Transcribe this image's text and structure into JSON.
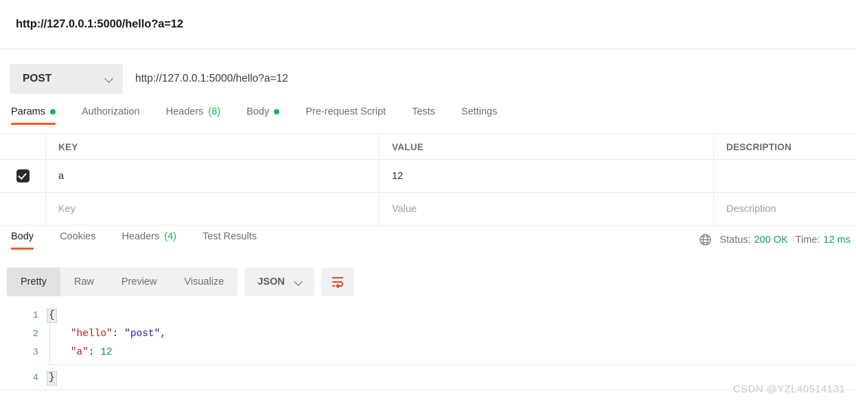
{
  "titlebar": {
    "title": "http://127.0.0.1:5000/hello?a=12"
  },
  "request": {
    "method": "POST",
    "url": "http://127.0.0.1:5000/hello?a=12",
    "tabs": [
      {
        "label": "Params",
        "badge": "dot",
        "active": true
      },
      {
        "label": "Authorization",
        "badge": "",
        "active": false
      },
      {
        "label": "Headers",
        "badge": "(8)",
        "active": false
      },
      {
        "label": "Body",
        "badge": "dot",
        "active": false
      },
      {
        "label": "Pre-request Script",
        "badge": "",
        "active": false
      },
      {
        "label": "Tests",
        "badge": "",
        "active": false
      },
      {
        "label": "Settings",
        "badge": "",
        "active": false
      }
    ]
  },
  "params": {
    "columns": {
      "key": "KEY",
      "value": "VALUE",
      "description": "DESCRIPTION"
    },
    "rows": [
      {
        "checked": true,
        "key": "a",
        "value": "12",
        "description": ""
      }
    ],
    "placeholders": {
      "key": "Key",
      "value": "Value",
      "description": "Description"
    }
  },
  "response": {
    "tabs": [
      {
        "label": "Body",
        "badge": "",
        "active": true
      },
      {
        "label": "Cookies",
        "badge": "",
        "active": false
      },
      {
        "label": "Headers",
        "badge": "(4)",
        "active": false
      },
      {
        "label": "Test Results",
        "badge": "",
        "active": false
      }
    ],
    "status_label": "Status:",
    "status_value": "200 OK",
    "time_label": "Time:",
    "time_value": "12 ms",
    "globe_icon": "globe-icon"
  },
  "viewer": {
    "modes": [
      "Pretty",
      "Raw",
      "Preview",
      "Visualize"
    ],
    "active_mode": "Pretty",
    "format": "JSON",
    "wrap_icon": "word-wrap-icon"
  },
  "code": {
    "lines": [
      {
        "n": "1",
        "brace": "{"
      },
      {
        "n": "2",
        "key": "\"hello\"",
        "colon": ": ",
        "str": "\"post\"",
        "comma": ","
      },
      {
        "n": "3",
        "key": "\"a\"",
        "colon": ": ",
        "num": "12"
      },
      {
        "n": "4",
        "brace": "}"
      }
    ]
  },
  "watermark": "CSDN @YZL40514131",
  "colors": {
    "accent": "#ef5b25",
    "green": "#19b955",
    "status_green": "#14a04a",
    "json_key": "#9e1d1d",
    "json_string": "#1a1ab0",
    "json_number": "#0f8a62"
  }
}
